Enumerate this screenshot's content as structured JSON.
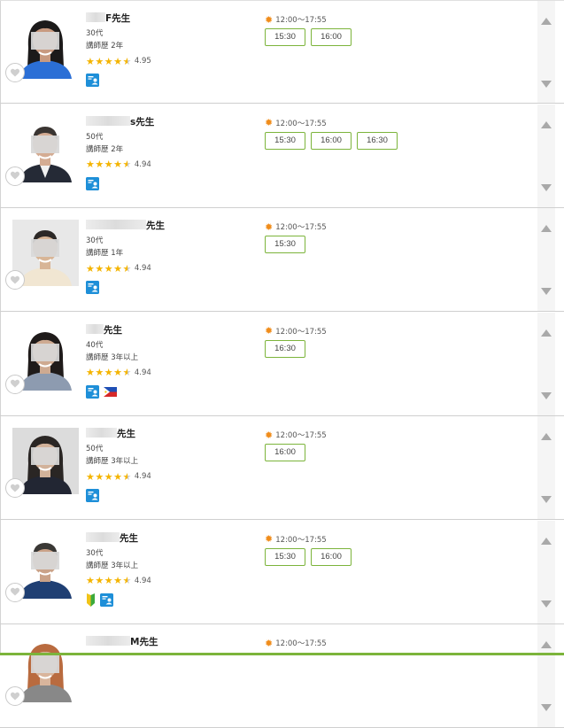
{
  "labels": {
    "experience_prefix": "講師歴"
  },
  "teachers": [
    {
      "name_visible": "F先生",
      "mask_w": 22,
      "age": "30代",
      "experience": "2年",
      "rating": "4.95",
      "half_star": true,
      "badges": [
        "student"
      ],
      "time_range": "12:00～17:55",
      "slots": [
        "15:30",
        "16:00"
      ],
      "photo": "p1"
    },
    {
      "name_visible": "s先生",
      "mask_w": 50,
      "age": "50代",
      "experience": "2年",
      "rating": "4.94",
      "half_star": true,
      "badges": [
        "student"
      ],
      "time_range": "12:00～17:55",
      "slots": [
        "15:30",
        "16:00",
        "16:30"
      ],
      "photo": "p2"
    },
    {
      "name_visible": "先生",
      "mask_w": 68,
      "age": "30代",
      "experience": "1年",
      "rating": "4.94",
      "half_star": true,
      "badges": [
        "student"
      ],
      "time_range": "12:00～17:55",
      "slots": [
        "15:30"
      ],
      "photo": "p3"
    },
    {
      "name_visible": "先生",
      "mask_w": 20,
      "age": "40代",
      "experience": "3年以上",
      "rating": "4.94",
      "half_star": true,
      "badges": [
        "student",
        "philippines-flag"
      ],
      "time_range": "12:00～17:55",
      "slots": [
        "16:30"
      ],
      "photo": "p4"
    },
    {
      "name_visible": "先生",
      "mask_w": 35,
      "age": "50代",
      "experience": "3年以上",
      "rating": "4.94",
      "half_star": true,
      "badges": [
        "student"
      ],
      "time_range": "12:00～17:55",
      "slots": [
        "16:00"
      ],
      "photo": "p5"
    },
    {
      "name_visible": "先生",
      "mask_w": 38,
      "age": "30代",
      "experience": "3年以上",
      "rating": "4.94",
      "half_star": true,
      "badges": [
        "beginner-mark",
        "student"
      ],
      "time_range": "12:00～17:55",
      "slots": [
        "15:30",
        "16:00"
      ],
      "photo": "p6"
    },
    {
      "name_visible": "M先生",
      "mask_w": 50,
      "age": "",
      "experience": "",
      "rating": "",
      "half_star": false,
      "badges": [],
      "time_range": "12:00～17:55",
      "slots": [],
      "photo": "p7"
    }
  ],
  "colors": {
    "accent_green": "#7cb43b",
    "star": "#f4b400",
    "sun": "#f08c1a",
    "badge_blue": "#1e8fd8"
  },
  "icons": {
    "favorite": "heart-icon",
    "time": "sun-icon",
    "scroll_up": "arrow-up-icon",
    "scroll_down": "arrow-down-icon",
    "student": "student-badge-icon"
  }
}
